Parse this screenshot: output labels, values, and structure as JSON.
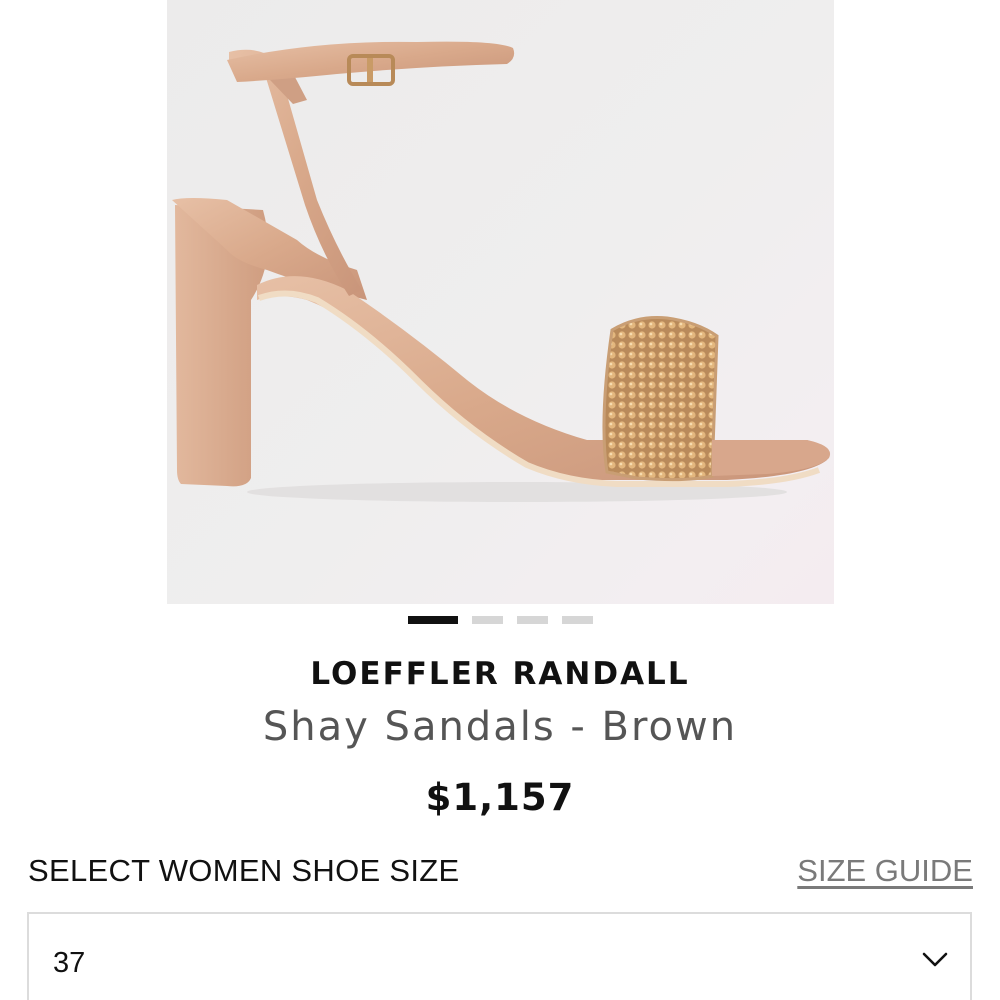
{
  "product": {
    "brand": "LOEFFLER RANDALL",
    "name": "Shay Sandals - Brown",
    "price": "$1,157"
  },
  "gallery": {
    "image_icon": "sandal-product-image",
    "dots_total": 4,
    "active_index": 0
  },
  "size": {
    "heading": "SELECT WOMEN SHOE SIZE",
    "guide_link": "SIZE GUIDE",
    "selected": "37",
    "dropdown_icon": "chevron-down-icon"
  },
  "colors": {
    "text": "#111111",
    "muted": "#7a7a7a",
    "dot_active": "#111111",
    "dot_inactive": "#d6d6d6",
    "sandal": "#d9a98b"
  }
}
